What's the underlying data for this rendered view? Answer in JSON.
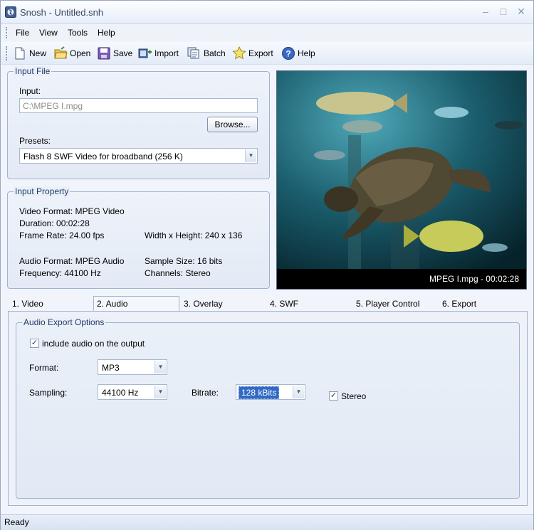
{
  "window": {
    "title": "Snosh - Untitled.snh"
  },
  "menu": [
    "File",
    "View",
    "Tools",
    "Help"
  ],
  "toolbar": [
    {
      "label": "New",
      "icon": "new-document-icon"
    },
    {
      "label": "Open",
      "icon": "open-folder-icon"
    },
    {
      "label": "Save",
      "icon": "save-disk-icon"
    },
    {
      "label": "Import",
      "icon": "import-icon"
    },
    {
      "label": "Batch",
      "icon": "batch-icon"
    },
    {
      "label": "Export",
      "icon": "export-star-icon"
    },
    {
      "label": "Help",
      "icon": "help-icon"
    }
  ],
  "input_file": {
    "legend": "Input File",
    "input_label": "Input:",
    "input_value": "C:\\MPEG I.mpg",
    "browse_label": "Browse...",
    "presets_label": "Presets:",
    "preset_value": "Flash 8 SWF Video for broadband (256 K)"
  },
  "input_property": {
    "legend": "Input Property",
    "video_format": "Video Format: MPEG Video",
    "duration": "Duration: 00:02:28",
    "frame_rate": "Frame Rate: 24.00 fps",
    "dimensions": "Width x Height: 240 x 136",
    "audio_format": "Audio Format: MPEG Audio",
    "sample_size": "Sample Size: 16 bits",
    "frequency": "Frequency: 44100 Hz",
    "channels": "Channels: Stereo"
  },
  "preview": {
    "caption": "MPEG I.mpg - 00:02:28"
  },
  "tabs": [
    "1. Video",
    "2. Audio",
    "3. Overlay",
    "4. SWF",
    "5. Player Control",
    "6. Export"
  ],
  "audio": {
    "legend": "Audio Export Options",
    "include_audio_label": "include audio on the output",
    "include_audio_checked": true,
    "format_label": "Format:",
    "format_value": "MP3",
    "sampling_label": "Sampling:",
    "sampling_value": "44100 Hz",
    "bitrate_label": "Bitrate:",
    "bitrate_value": "128 kBits",
    "stereo_label": "Stereo",
    "stereo_checked": true
  },
  "status": {
    "text": "Ready"
  },
  "colors": {
    "accent": "#316ac5",
    "group_border": "#9fb3d1",
    "legend_text": "#243a66"
  }
}
